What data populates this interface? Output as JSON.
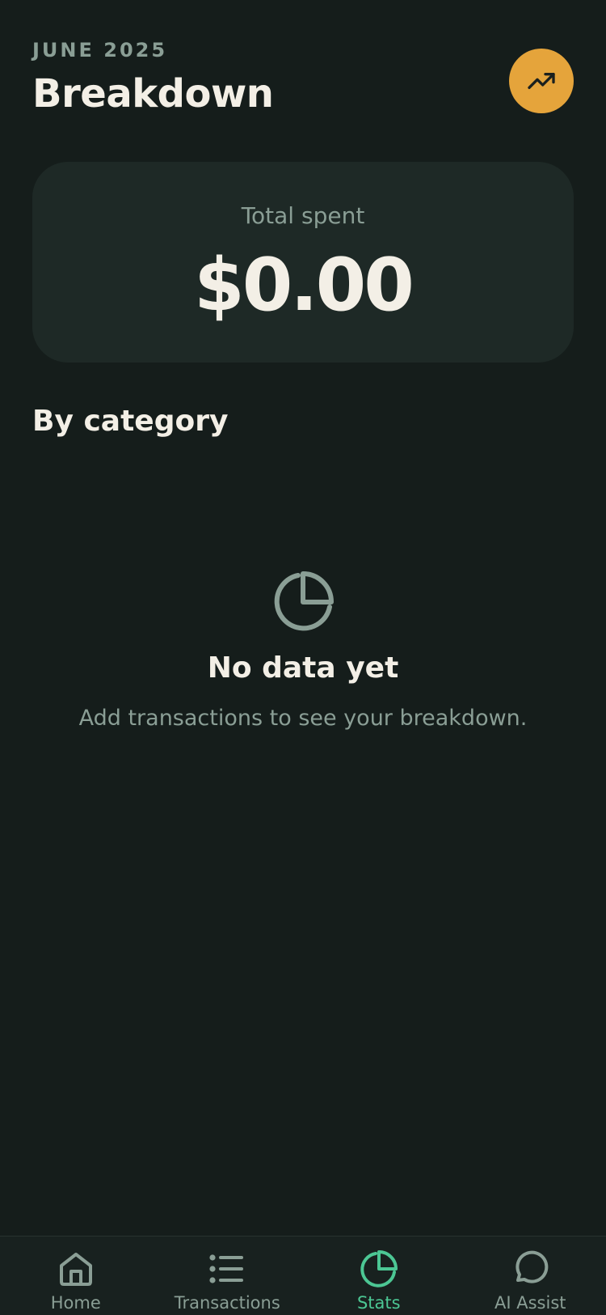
{
  "header": {
    "month": "JUNE 2025",
    "title": "Breakdown"
  },
  "summary": {
    "label": "Total spent",
    "amount": "$0.00"
  },
  "category_section": {
    "title": "By category"
  },
  "empty_state": {
    "icon": "pie-chart-icon",
    "title": "No data yet",
    "subtitle": "Add transactions to see your breakdown."
  },
  "tabs": [
    {
      "label": "Home",
      "icon": "home-icon",
      "active": false
    },
    {
      "label": "Transactions",
      "icon": "list-icon",
      "active": false
    },
    {
      "label": "Stats",
      "icon": "pie-chart-icon",
      "active": true
    },
    {
      "label": "AI Assist",
      "icon": "chat-bubble-icon",
      "active": false
    }
  ],
  "colors": {
    "background": "#151d1b",
    "card": "#1e2926",
    "accent": "#e5a43b",
    "active_tab": "#4cc794",
    "muted_text": "#8a9e95",
    "primary_text": "#f3efe6"
  }
}
